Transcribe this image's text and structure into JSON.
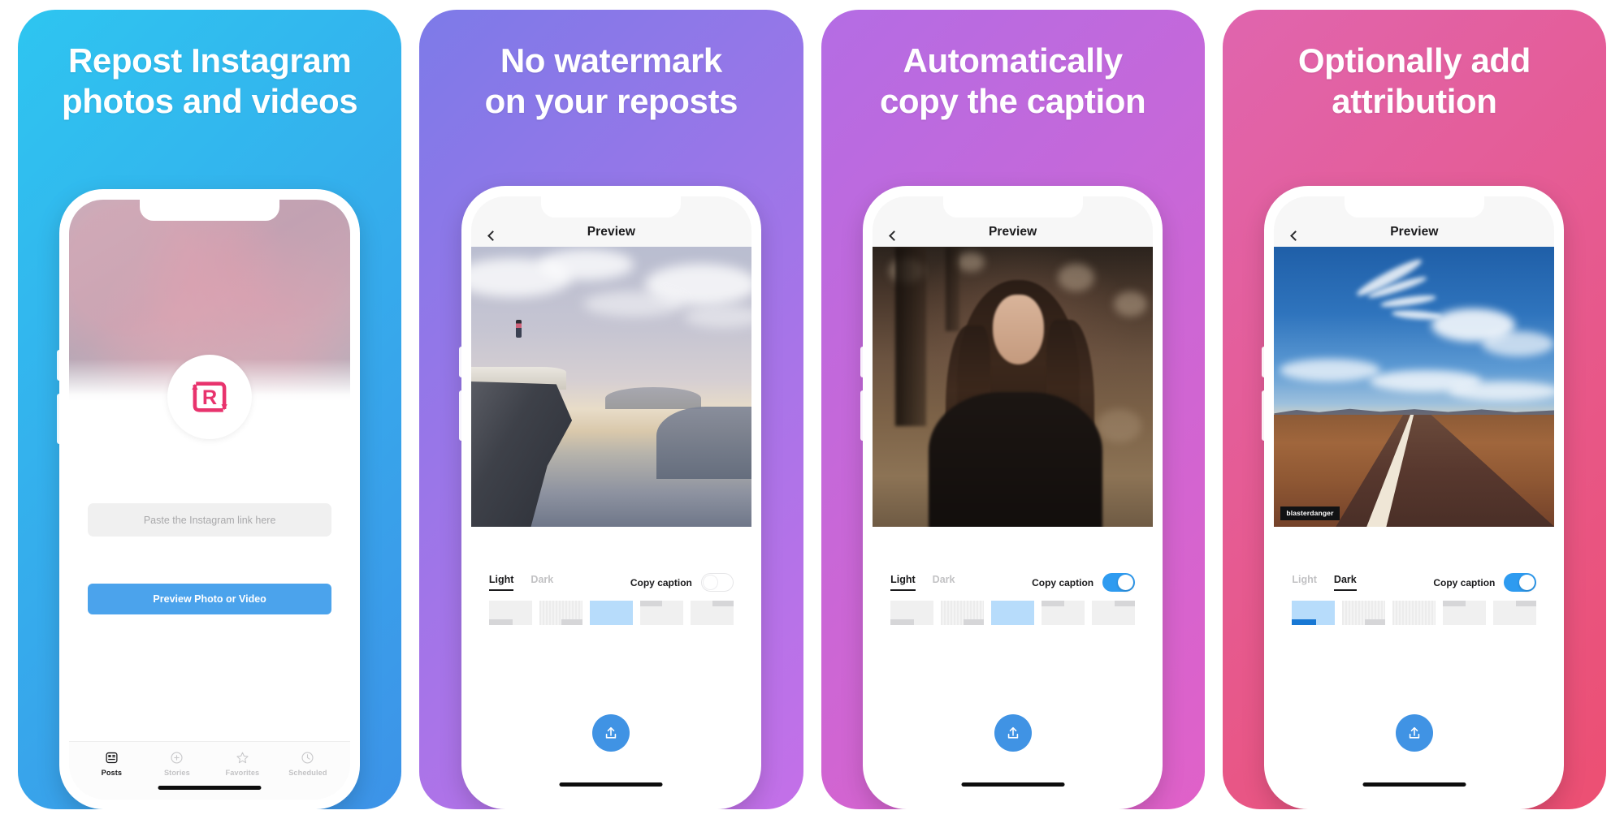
{
  "gallery": {
    "panels": [
      {
        "id": "panel-repost",
        "heading": "Repost Instagram\nphotos and videos",
        "gradient_from": "#2ec5f0",
        "gradient_to": "#3d93e8",
        "screen": {
          "type": "home",
          "nav": {
            "title": "Posts",
            "left_icon": "hamburger-menu-icon"
          },
          "logo": {
            "name": "repost-logo-icon",
            "color": "#e8336d"
          },
          "input": {
            "placeholder": "Paste the Instagram link here",
            "value": ""
          },
          "primary_button": "Preview Photo or Video",
          "tabbar": [
            {
              "label": "Posts",
              "icon": "posts-icon",
              "active": true
            },
            {
              "label": "Stories",
              "icon": "plus-circle-icon",
              "active": false
            },
            {
              "label": "Favorites",
              "icon": "star-icon",
              "active": false
            },
            {
              "label": "Scheduled",
              "icon": "clock-icon",
              "active": false
            }
          ]
        }
      },
      {
        "id": "panel-no-watermark",
        "heading": "No watermark\non your reposts",
        "gradient_from": "#7d7ae8",
        "gradient_to": "#c470e8",
        "screen": {
          "type": "preview",
          "nav": {
            "title": "Preview",
            "left_icon": "chevron-left-icon"
          },
          "photo": "cliff-hiker-photo",
          "attribution": null,
          "theme_tabs": [
            {
              "label": "Light",
              "active": true
            },
            {
              "label": "Dark",
              "active": false
            }
          ],
          "caption_label": "Copy caption",
          "caption_on": false,
          "selected_thumb": 2,
          "share_icon": "share-upload-icon",
          "accent": "#4093e4"
        }
      },
      {
        "id": "panel-copy-caption",
        "heading": "Automatically\ncopy the caption",
        "gradient_from": "#b46ce4",
        "gradient_to": "#e061c8",
        "screen": {
          "type": "preview",
          "nav": {
            "title": "Preview",
            "left_icon": "chevron-left-icon"
          },
          "photo": "woman-portrait-photo",
          "attribution": null,
          "theme_tabs": [
            {
              "label": "Light",
              "active": true
            },
            {
              "label": "Dark",
              "active": false
            }
          ],
          "caption_label": "Copy caption",
          "caption_on": true,
          "selected_thumb": 2,
          "share_icon": "share-upload-icon",
          "accent": "#4093e4"
        }
      },
      {
        "id": "panel-attribution",
        "heading": "Optionally add\nattribution",
        "gradient_from": "#e065ae",
        "gradient_to": "#ec4f72",
        "screen": {
          "type": "preview",
          "nav": {
            "title": "Preview",
            "left_icon": "chevron-left-icon"
          },
          "photo": "desert-road-photo",
          "attribution": "blasterdanger",
          "theme_tabs": [
            {
              "label": "Light",
              "active": false
            },
            {
              "label": "Dark",
              "active": true
            }
          ],
          "caption_label": "Copy caption",
          "caption_on": true,
          "selected_thumb": 0,
          "share_icon": "share-upload-icon",
          "accent": "#4093e4"
        }
      }
    ]
  }
}
